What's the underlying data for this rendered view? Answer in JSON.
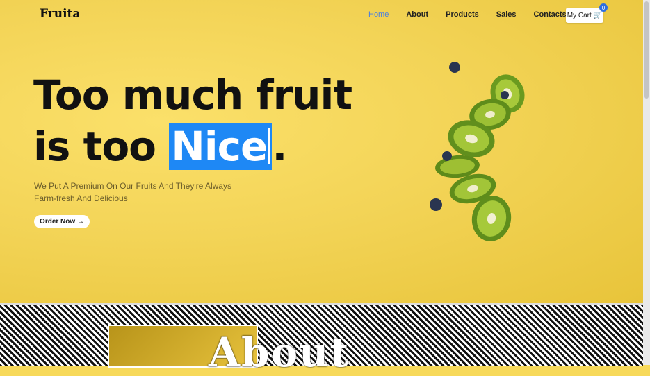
{
  "brand": {
    "name": "Fruita"
  },
  "nav": {
    "items": [
      {
        "label": "Home",
        "active": true
      },
      {
        "label": "About"
      },
      {
        "label": "Products"
      },
      {
        "label": "Sales"
      },
      {
        "label": "Contacts"
      }
    ],
    "cart": {
      "label": "My Cart",
      "count": "0"
    }
  },
  "hero": {
    "headline_line1": "Too much fruit",
    "headline_line2_prefix": "is too ",
    "headline_highlight": "Nice",
    "headline_suffix": ".",
    "subtitle": "We Put A Premium On Our Fruits And They're Always Farm-fresh And Delicious",
    "cta_label": "Order Now →"
  },
  "about": {
    "heading": "About"
  },
  "colors": {
    "hero_yellow": "#f3d457",
    "accent_blue": "#1e88f5",
    "nav_active": "#4a7ee0"
  }
}
